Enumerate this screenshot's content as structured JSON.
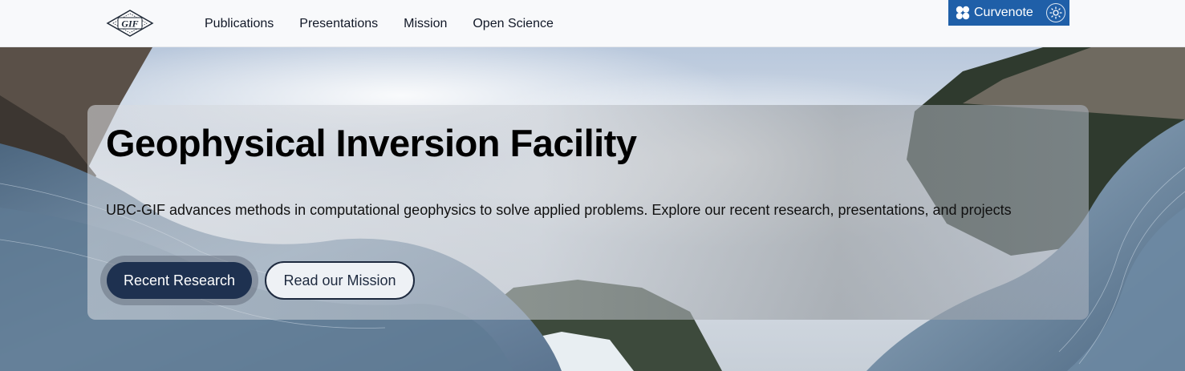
{
  "header": {
    "logo_text": "GIF",
    "nav": [
      {
        "label": "Publications"
      },
      {
        "label": "Presentations"
      },
      {
        "label": "Mission"
      },
      {
        "label": "Open Science"
      }
    ],
    "curvenote": {
      "label": "Curvenote"
    },
    "icons": {
      "logo": "gif-logo",
      "curvenote": "curvenote-logo-icon",
      "theme": "sun-icon"
    }
  },
  "hero": {
    "title": "Geophysical Inversion Facility",
    "subtitle": "UBC-GIF advances methods in computational geophysics to solve applied problems. Explore our recent research, presentations, and projects",
    "primary_button": "Recent Research",
    "secondary_button": "Read our Mission"
  },
  "colors": {
    "nav_bg": "#f8f9fb",
    "curvenote_bg": "#1f5fa8",
    "primary_button": "#1e3150",
    "secondary_border": "#1e2a3f"
  }
}
